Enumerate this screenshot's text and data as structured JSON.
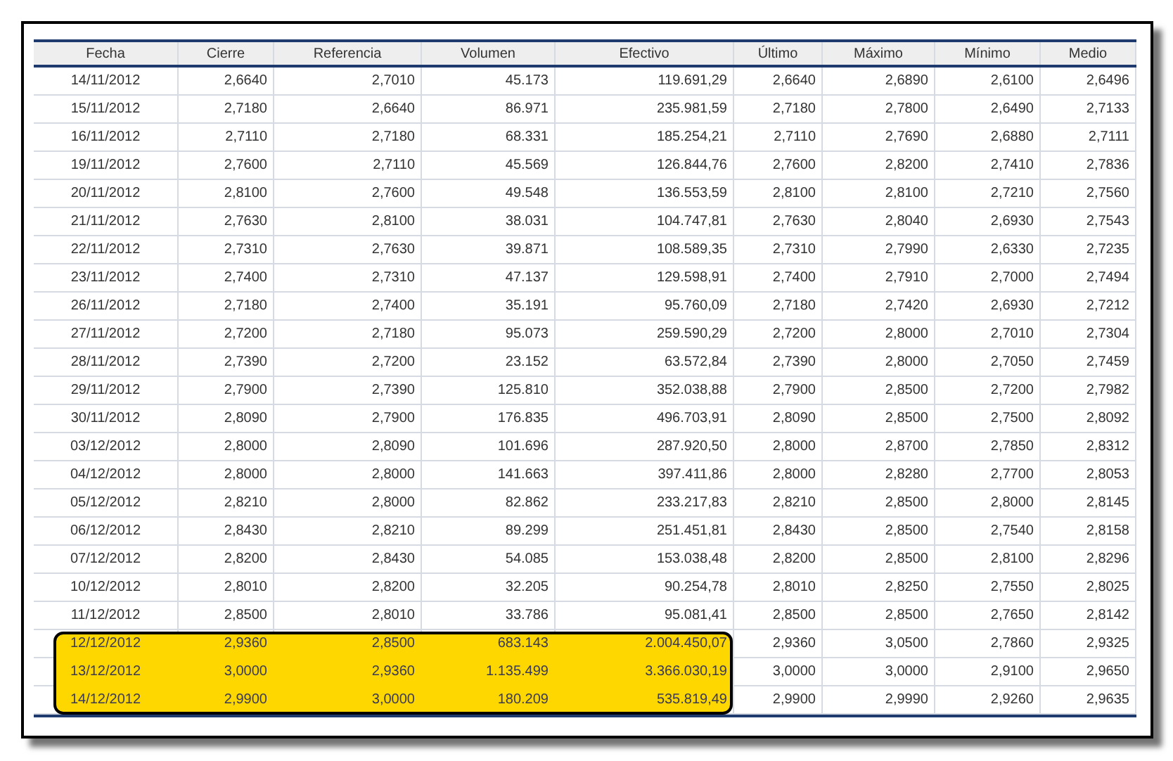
{
  "table": {
    "columns": [
      "Fecha",
      "Cierre",
      "Referencia",
      "Volumen",
      "Efectivo",
      "Último",
      "Máximo",
      "Mínimo",
      "Medio"
    ],
    "rows": [
      {
        "cells": [
          "14/11/2012",
          "2,6640",
          "2,7010",
          "45.173",
          "119.691,29",
          "2,6640",
          "2,6890",
          "2,6100",
          "2,6496"
        ],
        "highlighted": false
      },
      {
        "cells": [
          "15/11/2012",
          "2,7180",
          "2,6640",
          "86.971",
          "235.981,59",
          "2,7180",
          "2,7800",
          "2,6490",
          "2,7133"
        ],
        "highlighted": false
      },
      {
        "cells": [
          "16/11/2012",
          "2,7110",
          "2,7180",
          "68.331",
          "185.254,21",
          "2,7110",
          "2,7690",
          "2,6880",
          "2,7111"
        ],
        "highlighted": false
      },
      {
        "cells": [
          "19/11/2012",
          "2,7600",
          "2,7110",
          "45.569",
          "126.844,76",
          "2,7600",
          "2,8200",
          "2,7410",
          "2,7836"
        ],
        "highlighted": false
      },
      {
        "cells": [
          "20/11/2012",
          "2,8100",
          "2,7600",
          "49.548",
          "136.553,59",
          "2,8100",
          "2,8100",
          "2,7210",
          "2,7560"
        ],
        "highlighted": false
      },
      {
        "cells": [
          "21/11/2012",
          "2,7630",
          "2,8100",
          "38.031",
          "104.747,81",
          "2,7630",
          "2,8040",
          "2,6930",
          "2,7543"
        ],
        "highlighted": false
      },
      {
        "cells": [
          "22/11/2012",
          "2,7310",
          "2,7630",
          "39.871",
          "108.589,35",
          "2,7310",
          "2,7990",
          "2,6330",
          "2,7235"
        ],
        "highlighted": false
      },
      {
        "cells": [
          "23/11/2012",
          "2,7400",
          "2,7310",
          "47.137",
          "129.598,91",
          "2,7400",
          "2,7910",
          "2,7000",
          "2,7494"
        ],
        "highlighted": false
      },
      {
        "cells": [
          "26/11/2012",
          "2,7180",
          "2,7400",
          "35.191",
          "95.760,09",
          "2,7180",
          "2,7420",
          "2,6930",
          "2,7212"
        ],
        "highlighted": false
      },
      {
        "cells": [
          "27/11/2012",
          "2,7200",
          "2,7180",
          "95.073",
          "259.590,29",
          "2,7200",
          "2,8000",
          "2,7010",
          "2,7304"
        ],
        "highlighted": false
      },
      {
        "cells": [
          "28/11/2012",
          "2,7390",
          "2,7200",
          "23.152",
          "63.572,84",
          "2,7390",
          "2,8000",
          "2,7050",
          "2,7459"
        ],
        "highlighted": false
      },
      {
        "cells": [
          "29/11/2012",
          "2,7900",
          "2,7390",
          "125.810",
          "352.038,88",
          "2,7900",
          "2,8500",
          "2,7200",
          "2,7982"
        ],
        "highlighted": false
      },
      {
        "cells": [
          "30/11/2012",
          "2,8090",
          "2,7900",
          "176.835",
          "496.703,91",
          "2,8090",
          "2,8500",
          "2,7500",
          "2,8092"
        ],
        "highlighted": false
      },
      {
        "cells": [
          "03/12/2012",
          "2,8000",
          "2,8090",
          "101.696",
          "287.920,50",
          "2,8000",
          "2,8700",
          "2,7850",
          "2,8312"
        ],
        "highlighted": false
      },
      {
        "cells": [
          "04/12/2012",
          "2,8000",
          "2,8000",
          "141.663",
          "397.411,86",
          "2,8000",
          "2,8280",
          "2,7700",
          "2,8053"
        ],
        "highlighted": false
      },
      {
        "cells": [
          "05/12/2012",
          "2,8210",
          "2,8000",
          "82.862",
          "233.217,83",
          "2,8210",
          "2,8500",
          "2,8000",
          "2,8145"
        ],
        "highlighted": false
      },
      {
        "cells": [
          "06/12/2012",
          "2,8430",
          "2,8210",
          "89.299",
          "251.451,81",
          "2,8430",
          "2,8500",
          "2,7540",
          "2,8158"
        ],
        "highlighted": false
      },
      {
        "cells": [
          "07/12/2012",
          "2,8200",
          "2,8430",
          "54.085",
          "153.038,48",
          "2,8200",
          "2,8500",
          "2,8100",
          "2,8296"
        ],
        "highlighted": false
      },
      {
        "cells": [
          "10/12/2012",
          "2,8010",
          "2,8200",
          "32.205",
          "90.254,78",
          "2,8010",
          "2,8250",
          "2,7550",
          "2,8025"
        ],
        "highlighted": false
      },
      {
        "cells": [
          "11/12/2012",
          "2,8500",
          "2,8010",
          "33.786",
          "95.081,41",
          "2,8500",
          "2,8500",
          "2,7650",
          "2,8142"
        ],
        "highlighted": false
      },
      {
        "cells": [
          "12/12/2012",
          "2,9360",
          "2,8500",
          "683.143",
          "2.004.450,07",
          "2,9360",
          "3,0500",
          "2,7860",
          "2,9325"
        ],
        "highlighted": true
      },
      {
        "cells": [
          "13/12/2012",
          "3,0000",
          "2,9360",
          "1.135.499",
          "3.366.030,19",
          "3,0000",
          "3,0000",
          "2,9100",
          "2,9650"
        ],
        "highlighted": true
      },
      {
        "cells": [
          "14/12/2012",
          "2,9900",
          "3,0000",
          "180.209",
          "535.819,49",
          "2,9900",
          "2,9990",
          "2,9260",
          "2,9635"
        ],
        "highlighted": true
      }
    ]
  }
}
